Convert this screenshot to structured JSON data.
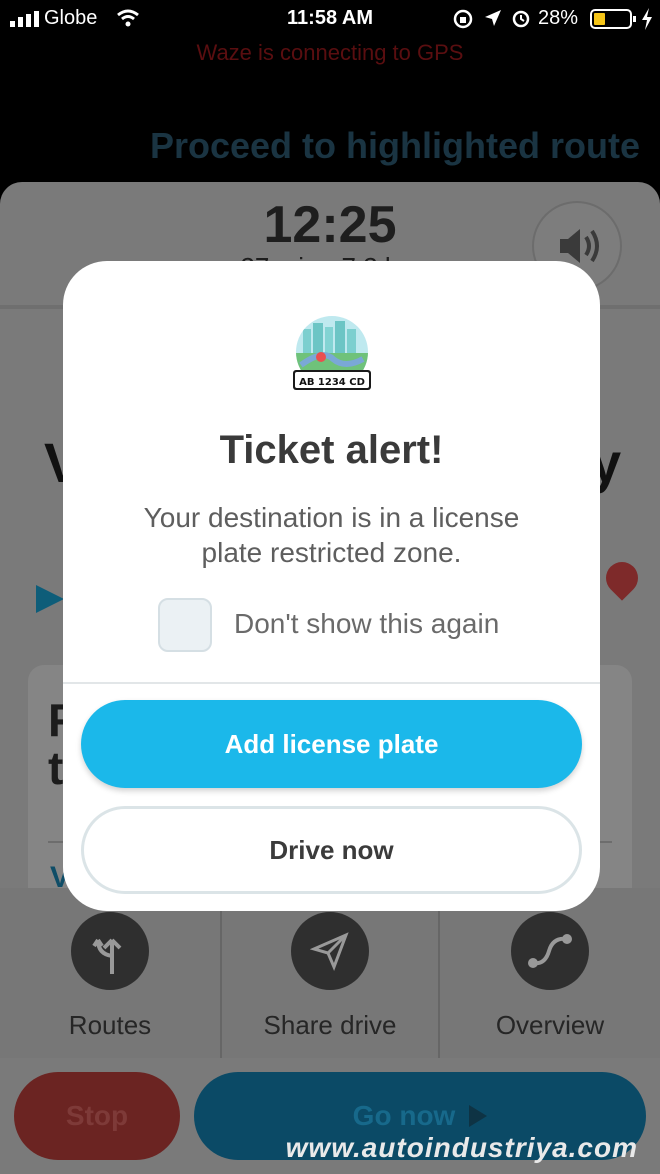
{
  "status_bar": {
    "carrier": "Globe",
    "time": "11:58 AM",
    "battery": "28%"
  },
  "nav": {
    "gps_message": "Waze is connecting to GPS",
    "instruction": "Proceed to highlighted route"
  },
  "eta": {
    "time": "12:25",
    "sub": "27 min · 7.3 km"
  },
  "background": {
    "letter_left": "V",
    "letter_right": "y",
    "card_letter_1": "F",
    "card_letter_2": "t",
    "card_link": "V"
  },
  "bottom_tabs": [
    {
      "label": "Routes",
      "icon": "fork-arrow-icon"
    },
    {
      "label": "Share drive",
      "icon": "paper-plane-icon"
    },
    {
      "label": "Overview",
      "icon": "route-curve-icon"
    }
  ],
  "actions": {
    "stop": "Stop",
    "go": "Go now"
  },
  "dialog": {
    "plate_text": "AB 1234 CD",
    "title": "Ticket alert!",
    "body": "Your destination is in a license plate restricted zone.",
    "checkbox_label": "Don't show this again",
    "checkbox_checked": false,
    "primary_button": "Add license plate",
    "secondary_button": "Drive now"
  },
  "watermark": "www.autoindustriya.com",
  "colors": {
    "accent": "#1bb8ea",
    "stop": "#6b2422",
    "go": "#0b4a66"
  }
}
